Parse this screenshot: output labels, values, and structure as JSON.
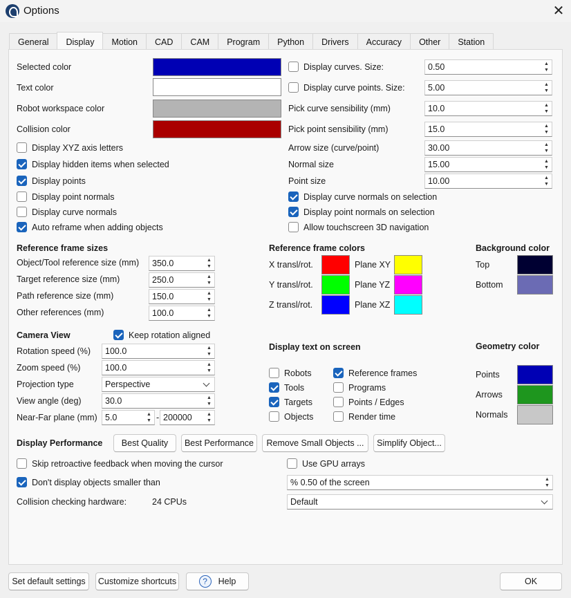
{
  "window": {
    "title": "Options"
  },
  "tabs": [
    "General",
    "Display",
    "Motion",
    "CAD",
    "CAM",
    "Program",
    "Python",
    "Drivers",
    "Accuracy",
    "Other",
    "Station"
  ],
  "colors": {
    "selected_color": {
      "label": "Selected color",
      "value": "#0000b4"
    },
    "text_color": {
      "label": "Text color",
      "value": "#ffffff"
    },
    "robot_workspace_color": {
      "label": "Robot workspace color",
      "value": "#b4b4b4"
    },
    "collision_color": {
      "label": "Collision color",
      "value": "#aa0000"
    }
  },
  "left_checks": [
    {
      "label": "Display XYZ axis letters",
      "checked": false
    },
    {
      "label": "Display hidden items when selected",
      "checked": true
    },
    {
      "label": "Display points",
      "checked": true
    },
    {
      "label": "Display point normals",
      "checked": false
    },
    {
      "label": "Display curve normals",
      "checked": false
    },
    {
      "label": "Auto reframe when adding objects",
      "checked": true
    }
  ],
  "right_params": {
    "display_curves": {
      "label": "Display curves. Size:",
      "checked": false,
      "value": "0.50"
    },
    "display_curve_points": {
      "label": "Display curve points. Size:",
      "checked": false,
      "value": "5.00"
    },
    "pick_curve": {
      "label": "Pick curve sensibility (mm)",
      "value": "10.0"
    },
    "pick_point": {
      "label": "Pick point sensibility (mm)",
      "value": "15.0"
    },
    "arrow_size": {
      "label": "Arrow size (curve/point)",
      "value": "30.00"
    },
    "normal_size": {
      "label": "Normal size",
      "value": "15.00"
    },
    "point_size": {
      "label": "Point size",
      "value": "10.00"
    }
  },
  "right_checks": [
    {
      "label": "Display curve normals on selection",
      "checked": true
    },
    {
      "label": "Display point normals on selection",
      "checked": true
    },
    {
      "label": "Allow touchscreen 3D navigation",
      "checked": false
    }
  ],
  "ref_sizes": {
    "title": "Reference frame sizes",
    "items": [
      {
        "label": "Object/Tool reference size (mm)",
        "value": "350.0"
      },
      {
        "label": "Target reference size (mm)",
        "value": "250.0"
      },
      {
        "label": "Path reference size (mm)",
        "value": "150.0"
      },
      {
        "label": "Other references (mm)",
        "value": "100.0"
      }
    ]
  },
  "ref_colors": {
    "title": "Reference frame colors",
    "x_label": "X transl/rot.",
    "x_color": "#ff0000",
    "y_label": "Y transl/rot.",
    "y_color": "#00ff00",
    "z_label": "Z transl/rot.",
    "z_color": "#0000ff",
    "xy_label": "Plane XY",
    "xy_color": "#ffff00",
    "yz_label": "Plane YZ",
    "yz_color": "#ff00ff",
    "xz_label": "Plane XZ",
    "xz_color": "#00ffff"
  },
  "background": {
    "title": "Background color",
    "top_label": "Top",
    "top_color": "#000032",
    "bottom_label": "Bottom",
    "bottom_color": "#6b6bb4"
  },
  "camera": {
    "title": "Camera View",
    "keep_rotation": {
      "label": "Keep rotation aligned",
      "checked": true
    },
    "rotation_speed": {
      "label": "Rotation speed (%)",
      "value": "100.0"
    },
    "zoom_speed": {
      "label": "Zoom speed (%)",
      "value": "100.0"
    },
    "projection": {
      "label": "Projection type",
      "value": "Perspective"
    },
    "view_angle": {
      "label": "View angle (deg)",
      "value": "30.0"
    },
    "near_far": {
      "label": "Near-Far plane (mm)",
      "near": "5.0",
      "separator": "-",
      "far": "200000"
    }
  },
  "display_text": {
    "title": "Display text on screen",
    "left": [
      {
        "label": "Robots",
        "checked": false
      },
      {
        "label": "Tools",
        "checked": true
      },
      {
        "label": "Targets",
        "checked": true
      },
      {
        "label": "Objects",
        "checked": false
      }
    ],
    "right": [
      {
        "label": "Reference frames",
        "checked": true
      },
      {
        "label": "Programs",
        "checked": false
      },
      {
        "label": "Points / Edges",
        "checked": false
      },
      {
        "label": "Render time",
        "checked": false
      }
    ]
  },
  "geometry": {
    "title": "Geometry color",
    "points_label": "Points",
    "points_color": "#0000b4",
    "arrows_label": "Arrows",
    "arrows_color": "#1e961e",
    "normals_label": "Normals",
    "normals_color": "#c8c8c8"
  },
  "performance": {
    "title": "Display Performance",
    "buttons": [
      "Best Quality",
      "Best Performance",
      "Remove Small Objects ...",
      "Simplify Object..."
    ],
    "skip_feedback": {
      "label": "Skip retroactive feedback when moving the cursor",
      "checked": false
    },
    "use_gpu": {
      "label": "Use GPU arrays",
      "checked": false
    },
    "dont_display_small": {
      "label": "Don't display objects smaller than",
      "checked": true
    },
    "screen_percent": "% 0.50 of the screen",
    "collision_label": "Collision checking hardware:",
    "collision_value": "24 CPUs",
    "hardware_select": "Default"
  },
  "footer": {
    "set_default": "Set default settings",
    "customize": "Customize shortcuts",
    "help": "Help",
    "ok": "OK"
  }
}
